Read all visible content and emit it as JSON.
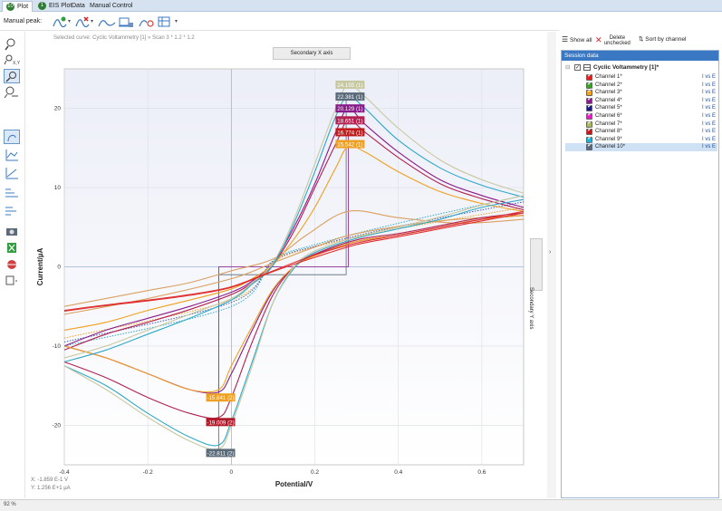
{
  "tabs": [
    {
      "label": "Plot",
      "num": "10"
    },
    {
      "label": "EIS Plot",
      "num": "1"
    },
    {
      "label": "Data",
      "num": ""
    },
    {
      "label": "Manual Control",
      "num": ""
    }
  ],
  "toolbar": {
    "manual_peak_label": "Manual peak:",
    "icons": [
      "peak-add-icon",
      "peak-remove-icon",
      "peak-fit-icon",
      "baseline-icon",
      "peak-search-icon",
      "peak-table-icon"
    ]
  },
  "plot": {
    "selected_curve": "Selected curve: Cyclic Voltammetry [1] » Scan 3 * 1.2 * 1.2",
    "secondary_x": "Secondary X axis",
    "secondary_y": "Secondary Y axis",
    "coord_x": "X: -1.859 E-1 V",
    "coord_y": "Y: 1.256 E+1 µA"
  },
  "session": {
    "show_all": "Show all",
    "delete_unchecked": "Delete unchecked",
    "sort_by_channel": "Sort by channel",
    "header": "Session data",
    "root": "Cyclic Voltammetry [1]*",
    "channels": [
      {
        "label": "Channel 1*",
        "sub": "I vs E",
        "color": "#e02020"
      },
      {
        "label": "Channel 2*",
        "sub": "I vs E",
        "color": "#3aa02c"
      },
      {
        "label": "Channel 3*",
        "sub": "I vs E",
        "color": "#f0a020"
      },
      {
        "label": "Channel 4*",
        "sub": "I vs E",
        "color": "#8a1a8a"
      },
      {
        "label": "Channel 5*",
        "sub": "I vs E",
        "color": "#1a1a80"
      },
      {
        "label": "Channel 6*",
        "sub": "I vs E",
        "color": "#e020c0"
      },
      {
        "label": "Channel 7*",
        "sub": "I vs E",
        "color": "#a8b860"
      },
      {
        "label": "Channel 8*",
        "sub": "I vs E",
        "color": "#c01a1a"
      },
      {
        "label": "Channel 9*",
        "sub": "I vs E",
        "color": "#20b0d8"
      },
      {
        "label": "Channel 10*",
        "sub": "I vs E",
        "color": "#5a6a78"
      }
    ]
  },
  "status": {
    "zoom": "92 %"
  },
  "chart_data": {
    "type": "line",
    "title": "",
    "xlabel": "Potential/V",
    "ylabel": "Current/µA",
    "xlim": [
      -0.4,
      0.7
    ],
    "ylim": [
      -25,
      25
    ],
    "xticks": [
      -0.4,
      -0.2,
      0.0,
      0.2,
      0.4,
      0.6
    ],
    "yticks": [
      20,
      10,
      0,
      -10,
      -20
    ],
    "grid": true,
    "cursor_lines": {
      "x": 0.0,
      "y": 0
    },
    "series": [
      {
        "name": "Channel 1",
        "color": "#d9a060",
        "forward": [
          [
            -0.4,
            -5
          ],
          [
            -0.2,
            -3
          ],
          [
            -0.1,
            -2
          ],
          [
            0,
            -0.5
          ],
          [
            0.1,
            1
          ],
          [
            0.18,
            4
          ],
          [
            0.28,
            7
          ],
          [
            0.4,
            6.2
          ],
          [
            0.55,
            5.5
          ],
          [
            0.7,
            6
          ]
        ],
        "reverse": [
          [
            0.7,
            6.5
          ],
          [
            0.5,
            5.8
          ],
          [
            0.3,
            4.2
          ],
          [
            0.2,
            2.5
          ],
          [
            0.1,
            0.5
          ],
          [
            0,
            -1.5
          ],
          [
            -0.2,
            -4
          ],
          [
            -0.4,
            -6
          ]
        ]
      },
      {
        "name": "Channel 4",
        "color": "#8a1a8a",
        "forward": [
          [
            -0.4,
            -10
          ],
          [
            -0.3,
            -8
          ],
          [
            -0.2,
            -6.5
          ],
          [
            -0.1,
            -5
          ],
          [
            0,
            -3.2
          ],
          [
            0.05,
            -1.8
          ],
          [
            0.1,
            0.5
          ],
          [
            0.15,
            5
          ],
          [
            0.2,
            10.5
          ],
          [
            0.25,
            17
          ],
          [
            0.28,
            20
          ],
          [
            0.32,
            18
          ],
          [
            0.4,
            14.5
          ],
          [
            0.5,
            11
          ],
          [
            0.6,
            9
          ],
          [
            0.7,
            7.5
          ]
        ],
        "reverse": [
          [
            0.7,
            6.5
          ],
          [
            0.6,
            6
          ],
          [
            0.5,
            5
          ],
          [
            0.4,
            4
          ],
          [
            0.3,
            3.2
          ],
          [
            0.2,
            1.5
          ],
          [
            0.15,
            0
          ],
          [
            0.1,
            -3
          ],
          [
            0.05,
            -8
          ],
          [
            0,
            -13.5
          ],
          [
            -0.03,
            -15.8
          ],
          [
            -0.1,
            -15.5
          ],
          [
            -0.2,
            -13.5
          ],
          [
            -0.3,
            -11.5
          ],
          [
            -0.4,
            -10
          ]
        ]
      },
      {
        "name": "Channel 8",
        "color": "#b22050",
        "forward": [
          [
            -0.4,
            -10.5
          ],
          [
            -0.3,
            -8.5
          ],
          [
            -0.2,
            -7
          ],
          [
            -0.1,
            -5.4
          ],
          [
            0,
            -3.5
          ],
          [
            0.05,
            -2
          ],
          [
            0.1,
            0.3
          ],
          [
            0.15,
            4.5
          ],
          [
            0.2,
            10
          ],
          [
            0.25,
            15.5
          ],
          [
            0.28,
            18.5
          ],
          [
            0.32,
            17
          ],
          [
            0.4,
            13.8
          ],
          [
            0.5,
            10.5
          ],
          [
            0.6,
            8.6
          ],
          [
            0.7,
            7.2
          ]
        ],
        "reverse": [
          [
            0.7,
            6.8
          ],
          [
            0.6,
            6.2
          ],
          [
            0.5,
            5.2
          ],
          [
            0.4,
            4.2
          ],
          [
            0.3,
            3.4
          ],
          [
            0.2,
            1.6
          ],
          [
            0.15,
            0
          ],
          [
            0.1,
            -3.5
          ],
          [
            0.05,
            -9.5
          ],
          [
            0,
            -16.5
          ],
          [
            -0.03,
            -19
          ],
          [
            -0.1,
            -18.5
          ],
          [
            -0.2,
            -16.5
          ],
          [
            -0.3,
            -14
          ],
          [
            -0.4,
            -12
          ]
        ]
      },
      {
        "name": "Channel 3",
        "color": "#f0a020",
        "forward": [
          [
            -0.4,
            -8
          ],
          [
            -0.3,
            -7
          ],
          [
            -0.2,
            -5.5
          ],
          [
            -0.1,
            -4.2
          ],
          [
            0,
            -2.8
          ],
          [
            0.05,
            -1.5
          ],
          [
            0.1,
            0.3
          ],
          [
            0.15,
            3.5
          ],
          [
            0.2,
            7.5
          ],
          [
            0.25,
            12.5
          ],
          [
            0.28,
            15.2
          ],
          [
            0.32,
            14.5
          ],
          [
            0.4,
            12
          ],
          [
            0.5,
            9.5
          ],
          [
            0.6,
            8
          ],
          [
            0.7,
            7
          ]
        ],
        "reverse": [
          [
            0.7,
            6.5
          ],
          [
            0.6,
            6
          ],
          [
            0.5,
            5
          ],
          [
            0.4,
            4
          ],
          [
            0.3,
            3.2
          ],
          [
            0.2,
            1.4
          ],
          [
            0.15,
            0
          ],
          [
            0.1,
            -2.8
          ],
          [
            0.05,
            -7.5
          ],
          [
            0,
            -12.5
          ],
          [
            -0.03,
            -15.5
          ],
          [
            -0.1,
            -15.5
          ],
          [
            -0.2,
            -13.5
          ],
          [
            -0.3,
            -11.5
          ],
          [
            -0.4,
            -10
          ]
        ]
      },
      {
        "name": "Channel 9",
        "color": "#30a8c8",
        "forward": [
          [
            -0.4,
            -12
          ],
          [
            -0.3,
            -10.5
          ],
          [
            -0.2,
            -8.5
          ],
          [
            -0.1,
            -6.5
          ],
          [
            0,
            -4.2
          ],
          [
            0.05,
            -2.2
          ],
          [
            0.1,
            0.2
          ],
          [
            0.15,
            5.5
          ],
          [
            0.2,
            12
          ],
          [
            0.25,
            19
          ],
          [
            0.28,
            21.5
          ],
          [
            0.32,
            20
          ],
          [
            0.4,
            16
          ],
          [
            0.5,
            12.5
          ],
          [
            0.6,
            10.3
          ],
          [
            0.7,
            8.8
          ]
        ],
        "reverse": [
          [
            0.7,
            8.5
          ],
          [
            0.6,
            7.5
          ],
          [
            0.5,
            6
          ],
          [
            0.4,
            4.8
          ],
          [
            0.3,
            3.6
          ],
          [
            0.2,
            1.8
          ],
          [
            0.15,
            -0.2
          ],
          [
            0.1,
            -4.5
          ],
          [
            0.05,
            -12
          ],
          [
            0,
            -19.5
          ],
          [
            -0.03,
            -22.5
          ],
          [
            -0.1,
            -21.5
          ],
          [
            -0.2,
            -18.5
          ],
          [
            -0.3,
            -15
          ],
          [
            -0.4,
            -12.5
          ]
        ]
      },
      {
        "name": "Channel 7",
        "color": "#c8c8a0",
        "forward": [
          [
            -0.4,
            -11.5
          ],
          [
            -0.3,
            -10
          ],
          [
            -0.2,
            -8
          ],
          [
            -0.1,
            -6
          ],
          [
            0,
            -4
          ],
          [
            0.05,
            -2
          ],
          [
            0.1,
            0.5
          ],
          [
            0.15,
            6
          ],
          [
            0.2,
            13
          ],
          [
            0.25,
            20
          ],
          [
            0.28,
            23
          ],
          [
            0.32,
            21.5
          ],
          [
            0.4,
            17.5
          ],
          [
            0.5,
            13.5
          ],
          [
            0.6,
            11
          ],
          [
            0.7,
            9.3
          ]
        ],
        "reverse": [
          [
            0.7,
            9
          ],
          [
            0.6,
            7.8
          ],
          [
            0.5,
            6.3
          ],
          [
            0.4,
            5
          ],
          [
            0.3,
            3.8
          ],
          [
            0.2,
            2
          ],
          [
            0.15,
            0
          ],
          [
            0.1,
            -4.5
          ],
          [
            0.05,
            -12.5
          ],
          [
            0,
            -20
          ],
          [
            -0.03,
            -23
          ],
          [
            -0.1,
            -22
          ],
          [
            -0.2,
            -19
          ],
          [
            -0.3,
            -15.5
          ],
          [
            -0.4,
            -12.5
          ]
        ]
      },
      {
        "name": "Channel 1 (red)",
        "color": "#e03030",
        "forward": [
          [
            -0.4,
            -5.5
          ],
          [
            -0.3,
            -4.8
          ],
          [
            -0.2,
            -4.2
          ],
          [
            -0.1,
            -3.5
          ],
          [
            0,
            -2.5
          ],
          [
            0.1,
            -0.5
          ],
          [
            0.2,
            1.5
          ],
          [
            0.3,
            3
          ],
          [
            0.4,
            4
          ],
          [
            0.5,
            5
          ],
          [
            0.6,
            6
          ],
          [
            0.7,
            7
          ]
        ],
        "reverse": [
          [
            0.7,
            6.8
          ],
          [
            0.6,
            5.8
          ],
          [
            0.5,
            4.8
          ],
          [
            0.4,
            3.8
          ],
          [
            0.3,
            2.8
          ],
          [
            0.2,
            1.2
          ],
          [
            0.1,
            -0.6
          ],
          [
            0,
            -2.6
          ],
          [
            -0.1,
            -3.6
          ],
          [
            -0.2,
            -4.3
          ],
          [
            -0.3,
            -4.9
          ],
          [
            -0.4,
            -5.6
          ]
        ]
      }
    ],
    "dotted": [
      {
        "name": "Channel 3 dotted",
        "color": "#f0a020",
        "points": [
          [
            -0.4,
            -9
          ],
          [
            0,
            -4.2
          ],
          [
            0.1,
            0.6
          ],
          [
            0.2,
            2.5
          ],
          [
            0.4,
            4.8
          ],
          [
            0.7,
            7.5
          ]
        ]
      },
      {
        "name": "Channel 9 dotted",
        "color": "#30a8c8",
        "points": [
          [
            -0.4,
            -10
          ],
          [
            0,
            -5
          ],
          [
            0.1,
            0.8
          ],
          [
            0.2,
            2.8
          ],
          [
            0.4,
            5.5
          ],
          [
            0.7,
            9
          ]
        ]
      },
      {
        "name": "Channel 5 dotted",
        "color": "#4060b0",
        "points": [
          [
            -0.4,
            -9.5
          ],
          [
            0,
            -4.5
          ],
          [
            0.1,
            0.7
          ],
          [
            0.2,
            2.6
          ],
          [
            0.4,
            5.1
          ],
          [
            0.7,
            8.2
          ]
        ]
      }
    ],
    "step_segments": [
      {
        "color": "#8a1a8a",
        "points": [
          [
            -0.03,
            -16
          ],
          [
            -0.03,
            0
          ],
          [
            0.28,
            0
          ],
          [
            0.28,
            17
          ]
        ]
      },
      {
        "color": "#5a6a78",
        "points": [
          [
            -0.03,
            -23
          ],
          [
            -0.03,
            -1
          ],
          [
            0.275,
            -1
          ],
          [
            0.275,
            22
          ]
        ]
      }
    ],
    "peak_labels": [
      {
        "text": "24.155 (1)",
        "x": 0.28,
        "y": 23,
        "color": "#c8c8a0"
      },
      {
        "text": "22.381 (1)",
        "x": 0.28,
        "y": 21.5,
        "color": "#5a6a78"
      },
      {
        "text": "20.129 (1)",
        "x": 0.28,
        "y": 20,
        "color": "#8a1a8a"
      },
      {
        "text": "18.651 (1)",
        "x": 0.28,
        "y": 18.5,
        "color": "#b22050"
      },
      {
        "text": "16.774 (1)",
        "x": 0.28,
        "y": 17,
        "color": "#c01a1a"
      },
      {
        "text": "15.542 (1)",
        "x": 0.28,
        "y": 15.5,
        "color": "#f0a020"
      },
      {
        "text": "-15.841 (2)",
        "x": -0.03,
        "y": -16.5,
        "color": "#f0a020"
      },
      {
        "text": "-19.009 (2)",
        "x": -0.03,
        "y": -19.6,
        "color": "#b01a2a"
      },
      {
        "text": "-22.811 (2)",
        "x": -0.03,
        "y": -23.5,
        "color": "#5a6a78"
      }
    ]
  }
}
